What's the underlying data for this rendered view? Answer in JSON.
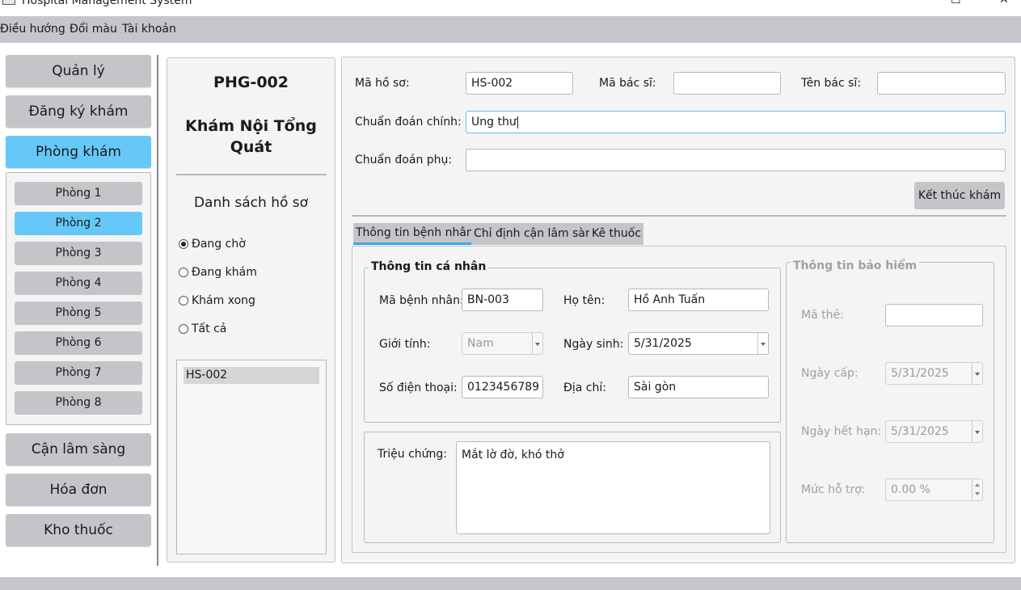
{
  "window": {
    "title": "Hospital Management System",
    "maximize_glyph": "☐",
    "close_glyph": "✕"
  },
  "menu": [
    "Điều hướng",
    "Đổi màu",
    "Tài khoản"
  ],
  "nav": {
    "items": [
      "Quản lý",
      "Đăng ký khám",
      "Phòng khám",
      "Cận lâm sàng",
      "Hóa đơn",
      "Kho thuốc"
    ],
    "active": "Phòng khám",
    "rooms": [
      "Phòng 1",
      "Phòng 2",
      "Phòng 3",
      "Phòng 4",
      "Phòng 5",
      "Phòng 6",
      "Phòng 7",
      "Phòng 8"
    ],
    "active_room": "Phòng 2"
  },
  "room_panel": {
    "code": "PHG-002",
    "name_line1": "Khám Nội Tổng",
    "name_line2": "Quát",
    "list_title": "Danh sách hồ sơ",
    "filters": [
      "Đang chờ",
      "Đang khám",
      "Khám xong",
      "Tất cả"
    ],
    "selected_filter": "Đang chờ",
    "records": [
      "HS-002"
    ]
  },
  "record": {
    "ma_ho_so_label": "Mã hồ sơ:",
    "ma_ho_so": "HS-002",
    "ma_bac_si_label": "Mã bác sĩ:",
    "ma_bac_si": "",
    "ten_bac_si_label": "Tên bác sĩ:",
    "ten_bac_si": "",
    "chuan_doan_chinh_label": "Chuẩn đoán chính:",
    "chuan_doan_chinh": "Ung thư",
    "chuan_doan_phu_label": "Chuẩn đoán phụ:",
    "chuan_doan_phu": "",
    "finish_button": "Kết thúc khám"
  },
  "tabs": [
    "Thông tin bệnh nhân",
    "Chỉ định cận lâm sàn",
    "Kê thuốc"
  ],
  "active_tab": "Thông tin bệnh nhân",
  "patient": {
    "group_title": "Thông tin cá nhân",
    "ma_benh_nhan_label": "Mã bệnh nhân:",
    "ma_benh_nhan": "BN-003",
    "ho_ten_label": "Họ tên:",
    "ho_ten": "Hồ Anh Tuấn",
    "gioi_tinh_label": "Giới tính:",
    "gioi_tinh": "Nam",
    "ngay_sinh_label": "Ngày sinh:",
    "ngay_sinh": "5/31/2025",
    "sdt_label": "Số điện thoại:",
    "sdt": "0123456789",
    "dia_chi_label": "Địa chỉ:",
    "dia_chi": "Sài gòn",
    "trieu_chung_label": "Triệu chứng:",
    "trieu_chung": "Mắt lờ đờ, khó thở"
  },
  "insurance": {
    "group_title": "Thông tin bảo hiểm",
    "ma_the_label": "Mã thẻ:",
    "ma_the": "",
    "ngay_cap_label": "Ngày cấp:",
    "ngay_cap": "5/31/2025",
    "ngay_het_han_label": "Ngày hết hạn:",
    "ngay_het_han": "5/31/2025",
    "muc_ho_tro_label": "Mức hỗ trợ:",
    "muc_ho_tro": "0.00 %"
  },
  "colors": {
    "accent": "#66c8f8",
    "button": "#c3c5c9",
    "menubar": "#c4c6ca",
    "tab_underline": "#3aa9e6"
  }
}
